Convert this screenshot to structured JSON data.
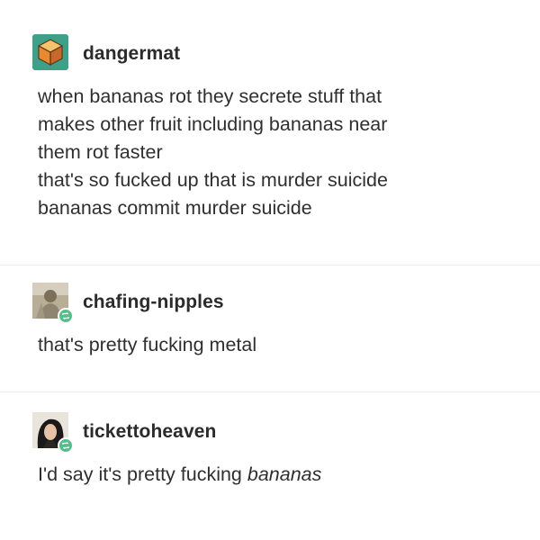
{
  "posts": [
    {
      "username": "dangermat",
      "avatar_icon": "cube-icon",
      "lines": [
        "when bananas rot they secrete stuff that",
        "makes other fruit including bananas near",
        "them rot faster",
        "that's so fucked up that is murder suicide",
        "bananas commit murder suicide"
      ]
    },
    {
      "username": "chafing-nipples",
      "avatar_icon": "person-photo-icon",
      "badge_icon": "reblog-icon",
      "lines": [
        "that's pretty fucking metal"
      ]
    },
    {
      "username": "tickettoheaven",
      "avatar_icon": "person-photo-icon",
      "badge_icon": "reblog-icon",
      "text_prefix": "I'd say it's pretty fucking ",
      "text_emphasis": "bananas"
    }
  ],
  "colors": {
    "reblog_badge": "#56bc8a",
    "cube_green": "#3fa08a",
    "cube_orange": "#e8892d",
    "divider": "#ececec"
  }
}
